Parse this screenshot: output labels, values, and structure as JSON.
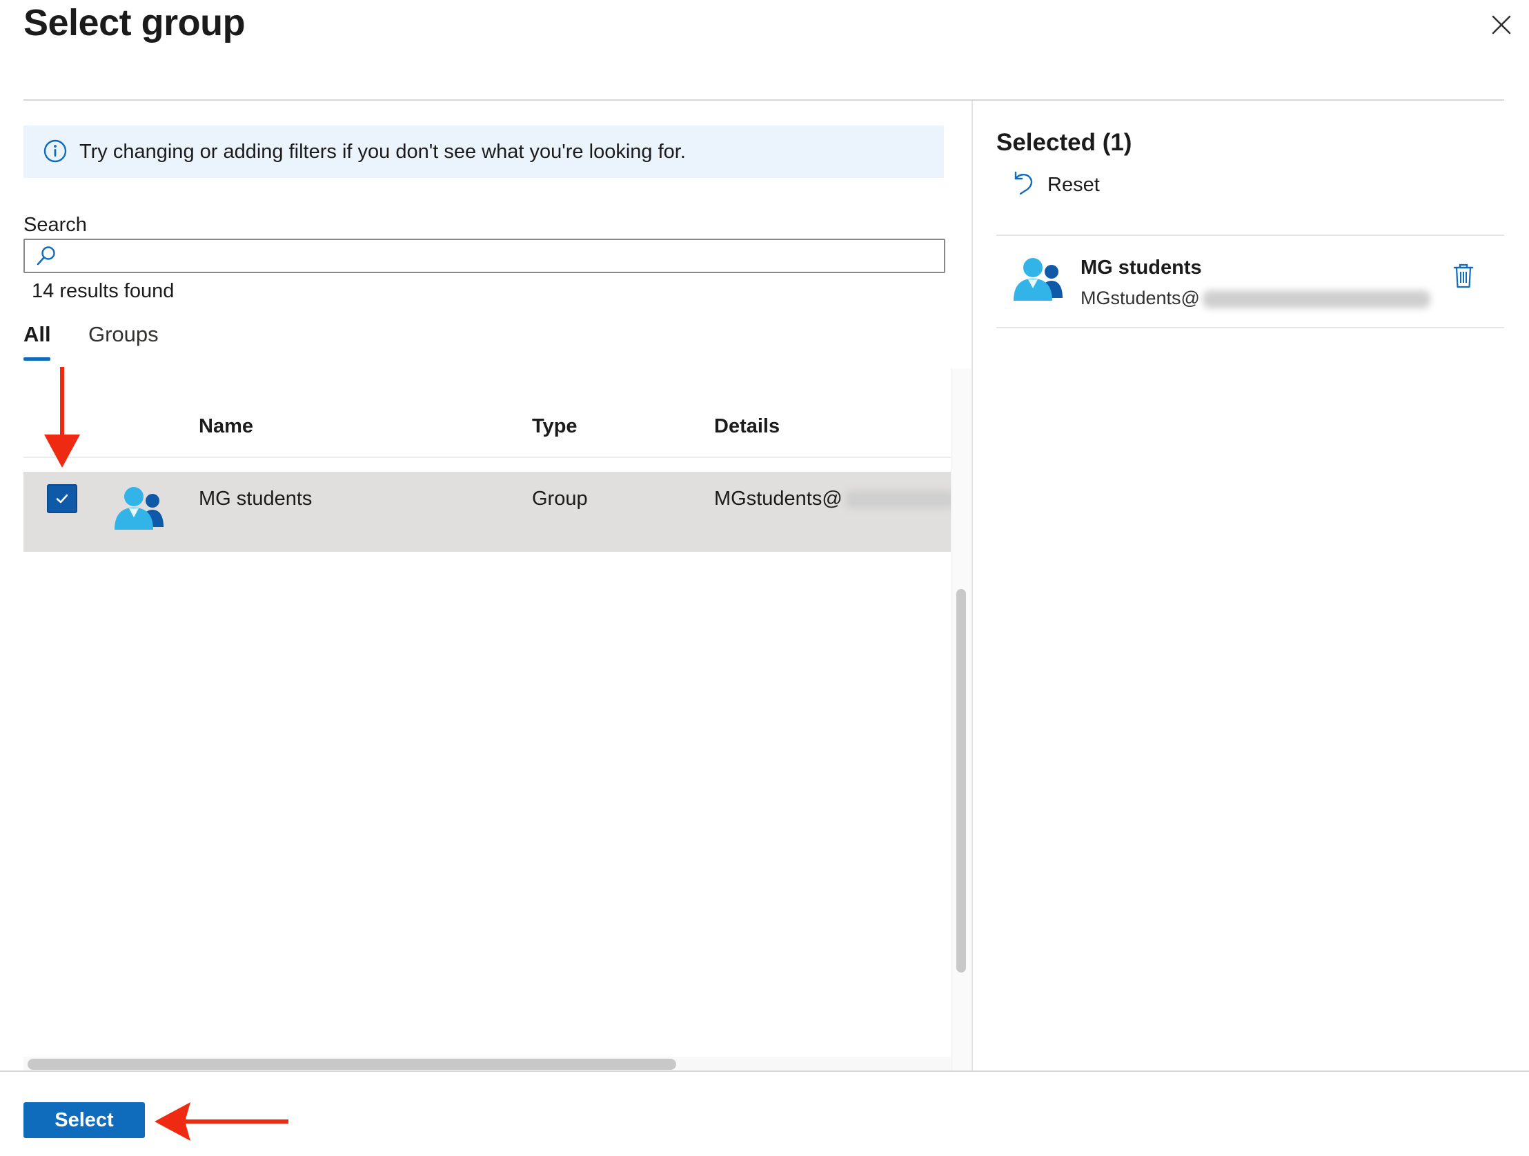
{
  "header": {
    "title": "Select group"
  },
  "info": {
    "message": "Try changing or adding filters if you don't see what you're looking for."
  },
  "search": {
    "label": "Search",
    "value": "",
    "results_text": "14 results found"
  },
  "tabs": [
    {
      "label": "All",
      "active": true
    },
    {
      "label": "Groups",
      "active": false
    }
  ],
  "table": {
    "columns": [
      "Name",
      "Type",
      "Details"
    ],
    "rows": [
      {
        "name": "MG students",
        "type": "Group",
        "details": "MGstudents@",
        "checked": true
      }
    ]
  },
  "selected_panel": {
    "title": "Selected (1)",
    "reset_label": "Reset",
    "items": [
      {
        "name": "MG students",
        "email": "MGstudents@"
      }
    ]
  },
  "footer": {
    "select_label": "Select"
  },
  "colors": {
    "accent": "#0f6cbd",
    "annotation": "#ee2a12",
    "info_bg": "#ebf3fc",
    "selected_row": "#e1dfdd"
  },
  "icons": [
    "close-icon",
    "info-icon",
    "search-icon",
    "group-icon",
    "reset-icon",
    "trash-icon",
    "checkmark-icon"
  ]
}
